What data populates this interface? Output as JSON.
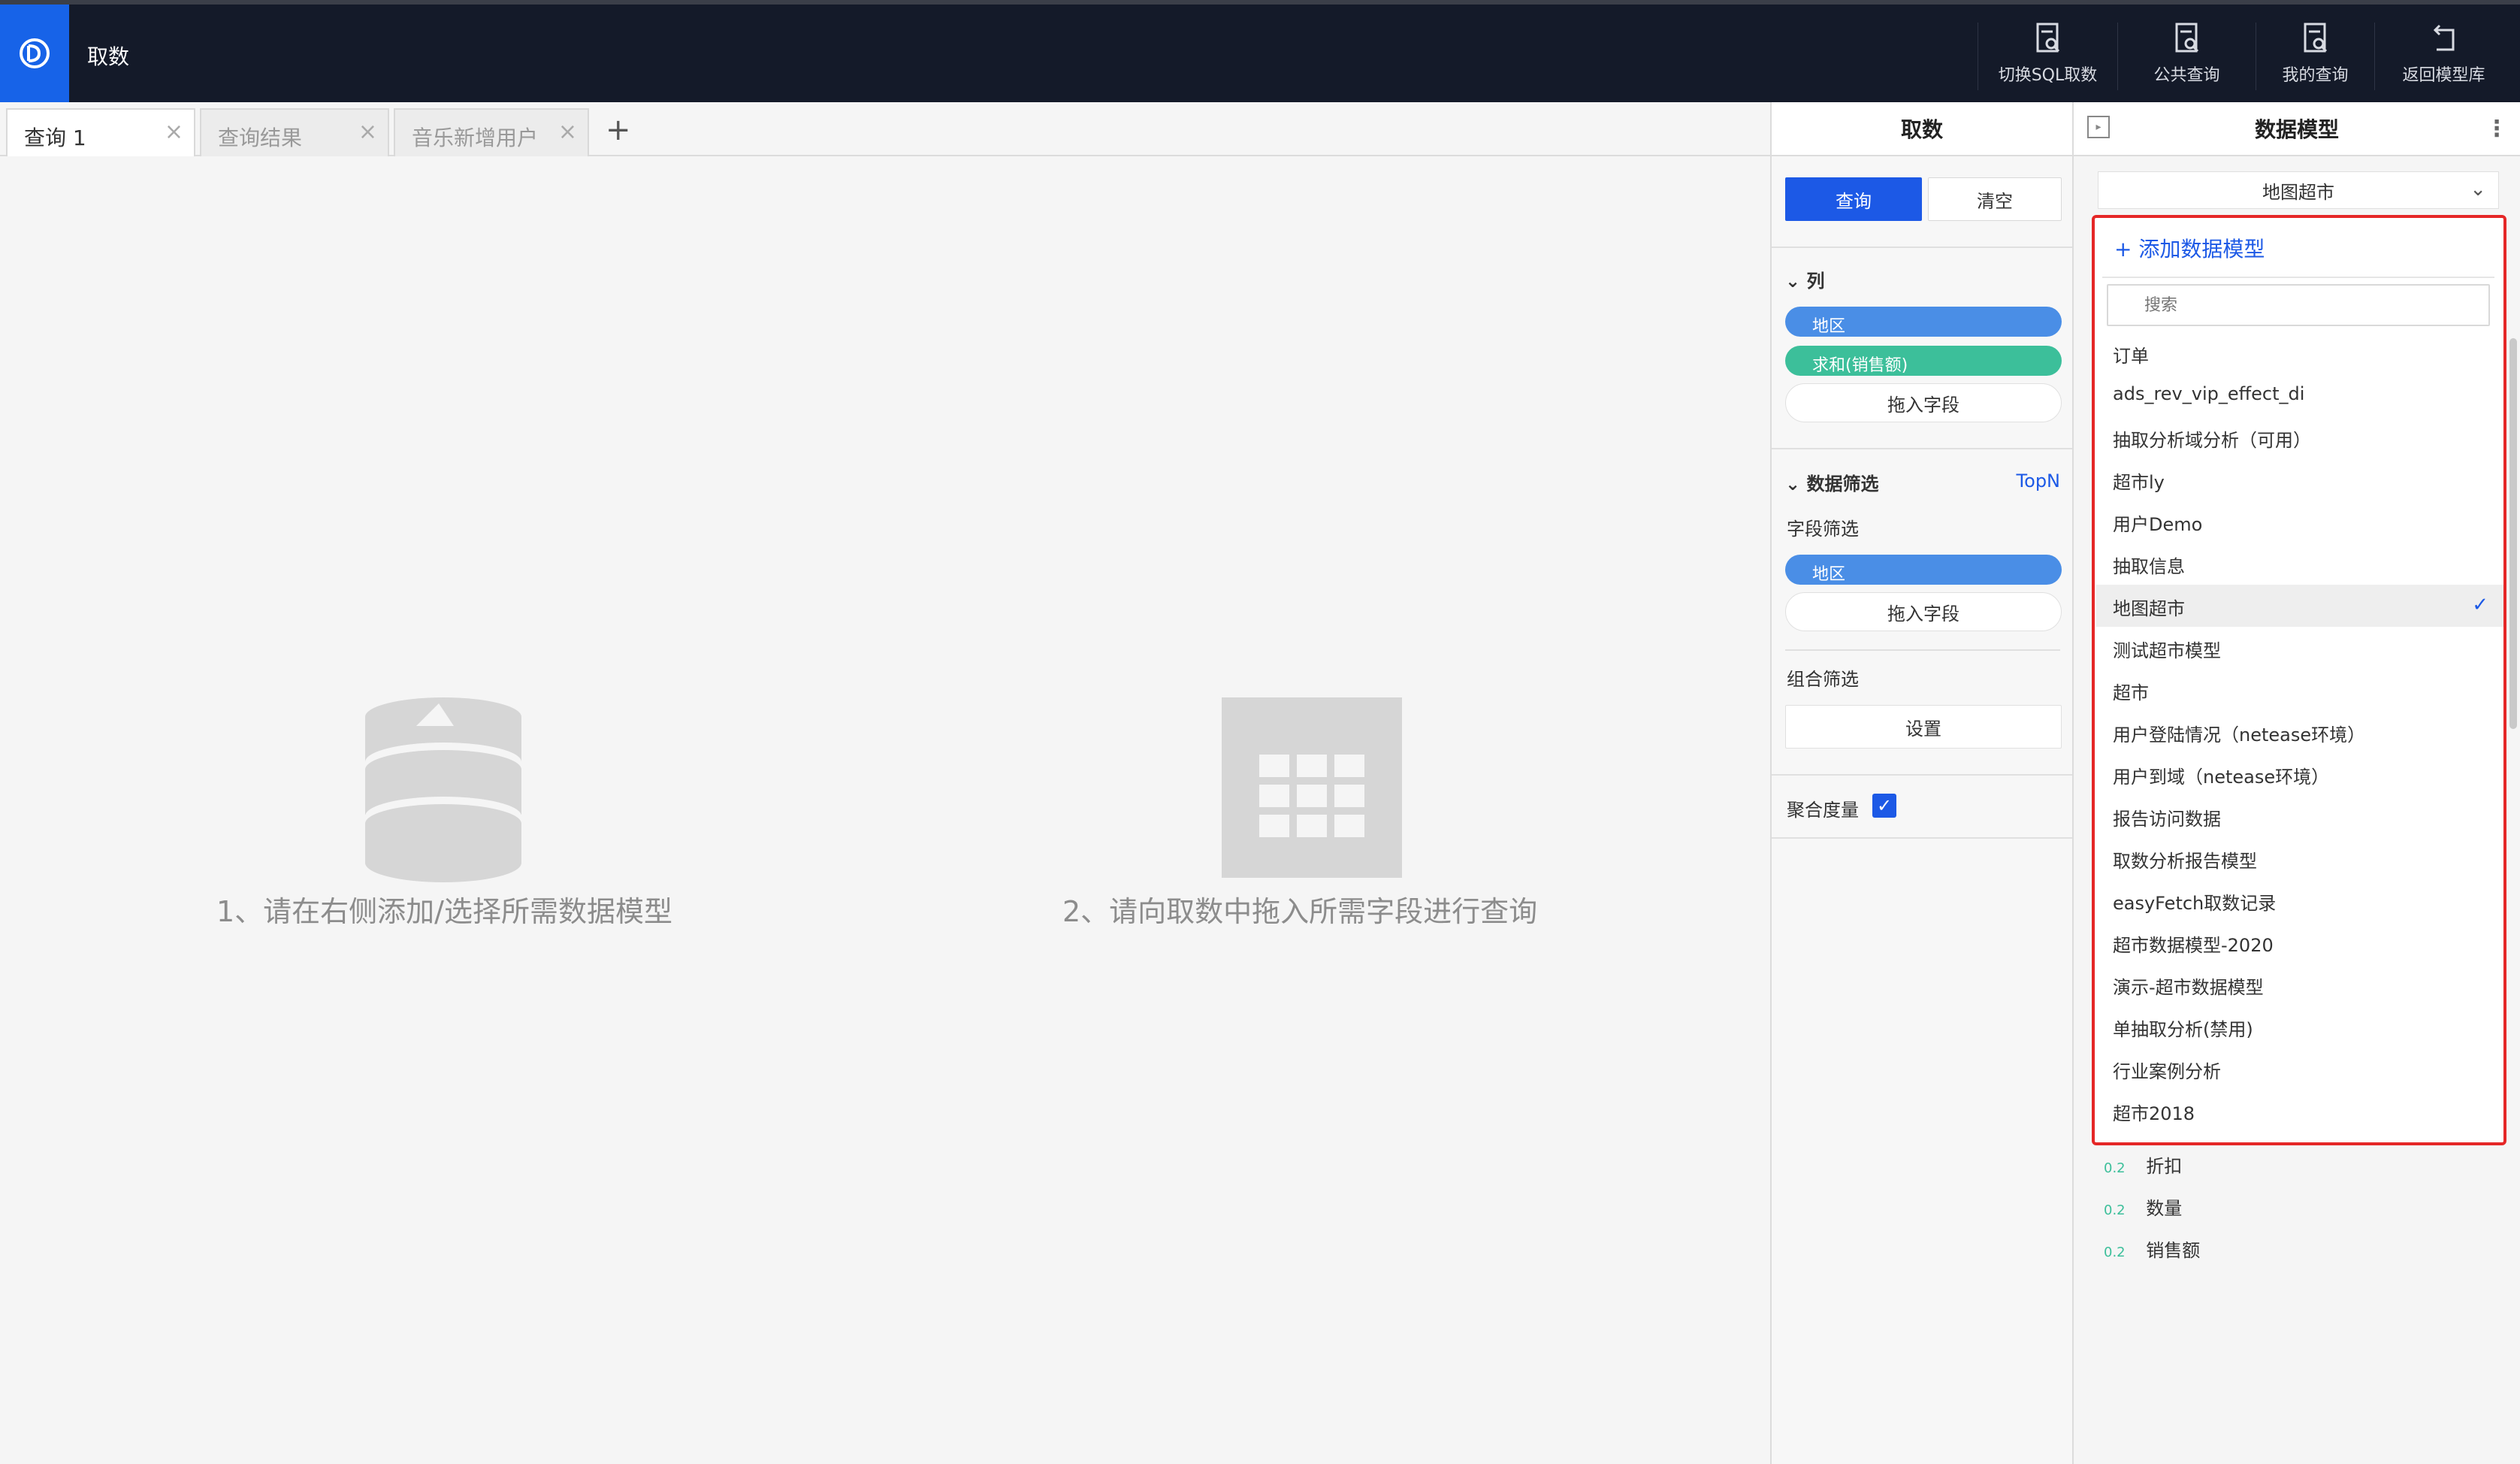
{
  "app": {
    "title": "取数"
  },
  "top_actions": [
    {
      "label": "切换SQL取数",
      "icon": "sql-query-icon"
    },
    {
      "label": "公共查询",
      "icon": "public-query-icon"
    },
    {
      "label": "我的查询",
      "icon": "my-query-icon"
    },
    {
      "label": "返回模型库",
      "icon": "return-icon"
    }
  ],
  "tabs": [
    {
      "label": "查询 1",
      "active": true
    },
    {
      "label": "查询结果",
      "active": false
    },
    {
      "label": "音乐新增用户",
      "active": false
    }
  ],
  "tab_add": "+",
  "canvas": {
    "hint1": "1、请在右侧添加/选择所需数据模型",
    "hint2": "2、请向取数中拖入所需字段进行查询"
  },
  "fetch_panel": {
    "title": "取数",
    "query_btn": "查询",
    "clear_btn": "清空",
    "columns_title": "列",
    "columns": [
      "地区",
      "求和(销售额)"
    ],
    "drop_label": "拖入字段",
    "filter_title": "数据筛选",
    "topn": "TopN",
    "field_filter_label": "字段筛选",
    "field_filters": [
      "地区"
    ],
    "combo_filter_label": "组合筛选",
    "settings_btn": "设置",
    "aggregate_label": "聚合度量"
  },
  "model_panel": {
    "title": "数据模型",
    "selected_model": "地图超市",
    "fields": [
      {
        "type": "0.2",
        "name": "折扣"
      },
      {
        "type": "0.2",
        "name": "数量"
      },
      {
        "type": "0.2",
        "name": "销售额"
      }
    ]
  },
  "dropdown": {
    "add_label": "添加数据模型",
    "search_placeholder": "搜索",
    "items": [
      "订单",
      "ads_rev_vip_effect_di",
      "抽取分析域分析（可用）",
      "超市ly",
      "用户Demo",
      "抽取信息",
      "地图超市",
      "测试超市模型",
      "超市",
      "用户登陆情况（netease环境）",
      "用户到域（netease环境）",
      "报告访问数据",
      "取数分析报告模型",
      "easyFetch取数记录",
      "超市数据模型-2020",
      "演示-超市数据模型",
      "单抽取分析(禁用)",
      "行业案例分析",
      "超市2018"
    ],
    "selected_index": 6
  },
  "colors": {
    "brand": "#1763e8",
    "topbar": "#141a29",
    "primary": "#1c59e6",
    "highlight_border": "#e52727",
    "pill_blue": "#4a8ee6",
    "pill_green": "#3cbf9a"
  }
}
